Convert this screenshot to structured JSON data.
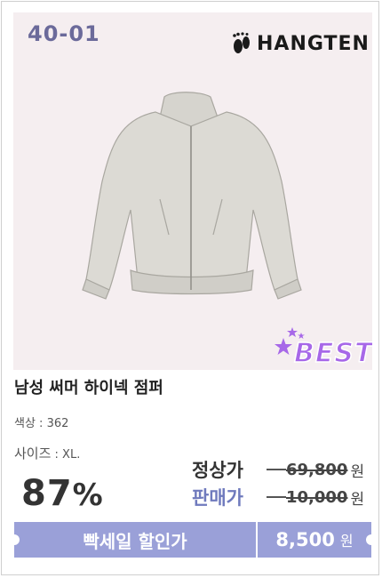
{
  "product": {
    "code": "40-01",
    "brand": "HANGTEN",
    "badge": "BEST",
    "title": "남성 써머 하이넥 점퍼",
    "color_label": "색상 : 362",
    "size_label": "사이즈",
    "size_value": " : XL."
  },
  "pricing": {
    "discount_value": "87",
    "discount_symbol": "%",
    "regular_label": "정상가",
    "regular_price": "69,800",
    "sale_label": "판매가",
    "sale_price": "10,000",
    "currency": "원"
  },
  "promo_bar": {
    "label": "빡세일 할인가",
    "amount": "8,500",
    "currency": "원"
  },
  "colors": {
    "accent": "#9aa0d8",
    "sale_label": "#6f7abd",
    "code": "#6b6a9a",
    "photo_bg": "#f5eef0",
    "best_fill": "#a768e8"
  }
}
